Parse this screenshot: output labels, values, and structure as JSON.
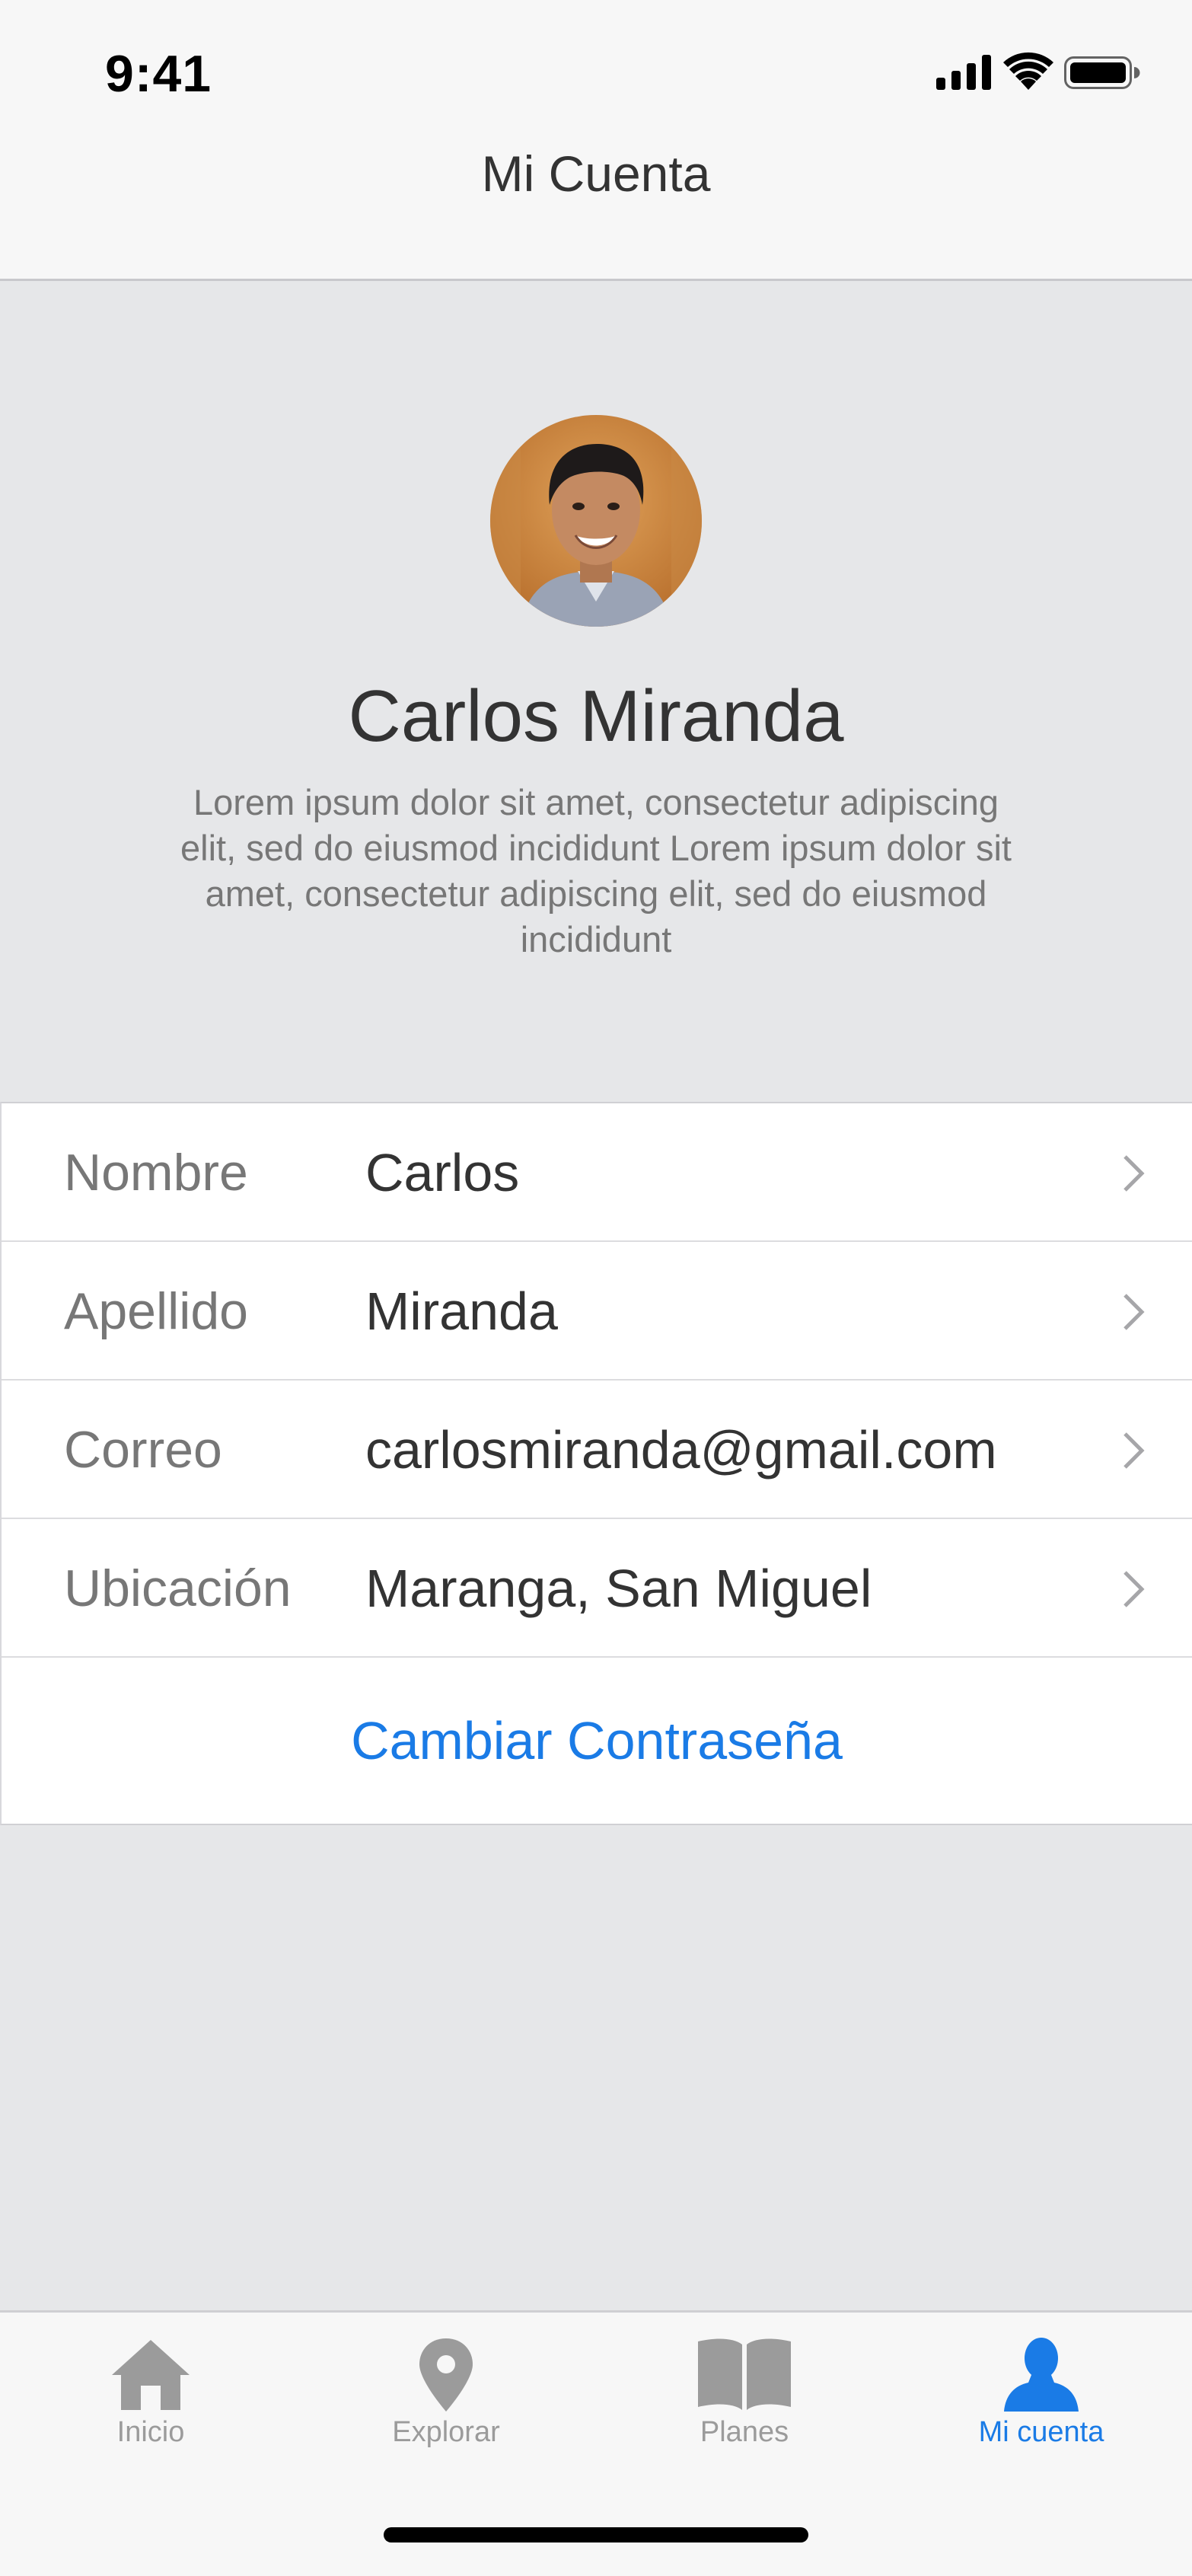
{
  "status_bar": {
    "time": "9:41"
  },
  "nav": {
    "title": "Mi Cuenta"
  },
  "profile": {
    "name": "Carlos Miranda",
    "bio": "Lorem ipsum dolor sit amet, consectetur adipiscing elit, sed do eiusmod   incididunt Lorem ipsum dolor sit amet, consectetur adipiscing elit, sed do eiusmod   incididunt"
  },
  "fields": [
    {
      "label": "Nombre",
      "value": "Carlos"
    },
    {
      "label": "Apellido",
      "value": "Miranda"
    },
    {
      "label": "Correo",
      "value": "carlosmiranda@gmail.com"
    },
    {
      "label": "Ubicación",
      "value": "Maranga, San Miguel"
    }
  ],
  "change_password": {
    "label": "Cambiar Contraseña"
  },
  "tabs": [
    {
      "label": "Inicio",
      "icon": "home-icon"
    },
    {
      "label": "Explorar",
      "icon": "location-pin-icon"
    },
    {
      "label": "Planes",
      "icon": "book-icon"
    },
    {
      "label": "Mi cuenta",
      "icon": "user-icon"
    }
  ],
  "colors": {
    "accent": "#1a7be6",
    "background": "#e6e7e9",
    "inactive_tab": "#9b9b9b"
  }
}
